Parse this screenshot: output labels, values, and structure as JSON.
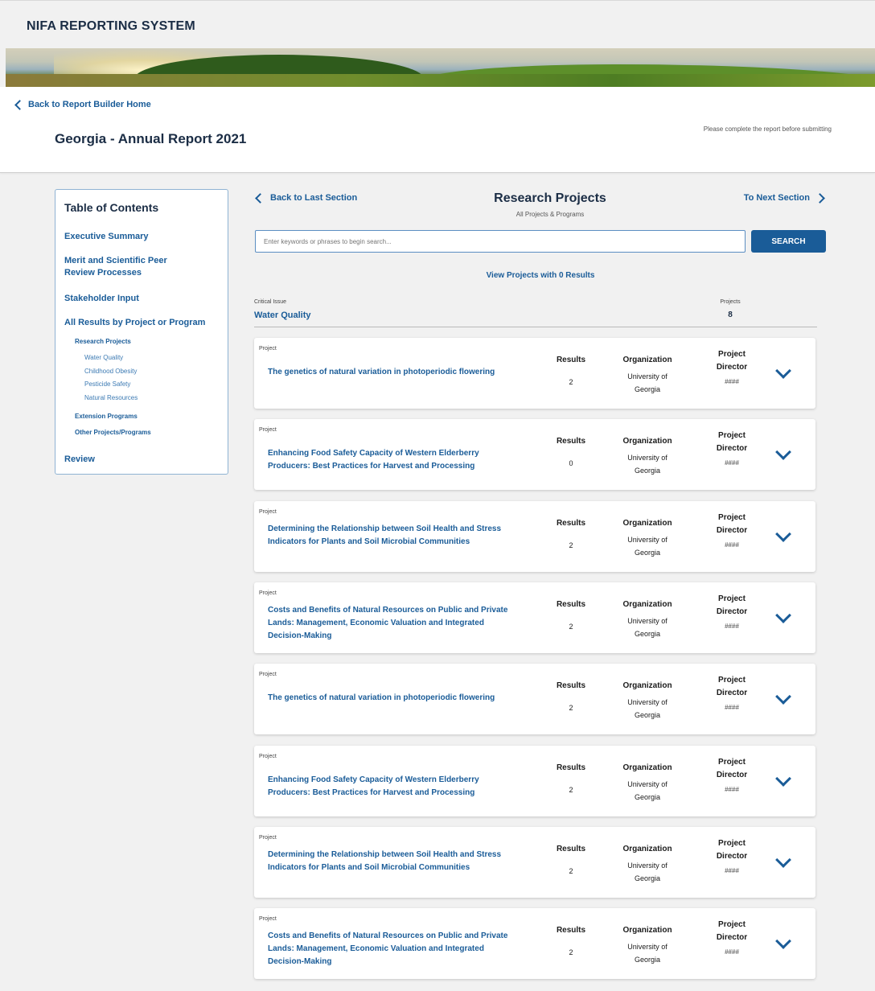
{
  "app": {
    "title": "NIFA REPORTING SYSTEM"
  },
  "header": {
    "back_link": "Back to Report Builder Home",
    "report_title": "Georgia - Annual Report 2021",
    "note": "Please complete the report before submitting"
  },
  "toc": {
    "title": "Table of Contents",
    "items": [
      {
        "label": "Executive Summary",
        "level": 1
      },
      {
        "label": "Merit and Scientific Peer Review Processes",
        "level": 1
      },
      {
        "label": "Stakeholder Input",
        "level": 1
      },
      {
        "label": "All Results by Project or Program",
        "level": 1
      },
      {
        "label": "Research Projects",
        "level": 2
      },
      {
        "label": "Water Quality",
        "level": 3
      },
      {
        "label": "Childhood Obesity",
        "level": 3
      },
      {
        "label": "Pesticide Safety",
        "level": 3
      },
      {
        "label": "Natural Resources",
        "level": 3
      },
      {
        "label": "Extension Programs",
        "level": 2
      },
      {
        "label": "Other Projects/Programs",
        "level": 2
      },
      {
        "label": "Review",
        "level": 1
      }
    ]
  },
  "section": {
    "back": "Back to Last Section",
    "next": "To Next Section",
    "title": "Research Projects",
    "subtitle": "All Projects & Programs"
  },
  "search": {
    "placeholder": "Enter keywords or phrases to begin search...",
    "button": "SEARCH"
  },
  "zero_results_link": "View Projects with 0 Results",
  "critical_issue": {
    "label": "Critical Issue",
    "value": "Water Quality",
    "projects_label": "Projects",
    "projects_count": "8"
  },
  "columns": {
    "kind": "Project",
    "results": "Results",
    "organization": "Organization",
    "director": "Project Director"
  },
  "projects": [
    {
      "title": "The genetics of natural variation in photoperiodic flowering",
      "results": "2",
      "organization": "University of Georgia",
      "director": "####"
    },
    {
      "title": "Enhancing Food Safety Capacity of Western Elderberry Producers: Best Practices for Harvest and Processing",
      "results": "0",
      "organization": "University of Georgia",
      "director": "####"
    },
    {
      "title": "Determining the Relationship between Soil Health and Stress Indicators for Plants and Soil Microbial Communities",
      "results": "2",
      "organization": "University of Georgia",
      "director": "####"
    },
    {
      "title": "Costs and Benefits of Natural Resources on Public and Private Lands: Management, Economic Valuation and Integrated Decision-Making",
      "results": "2",
      "organization": "University of Georgia",
      "director": "####"
    },
    {
      "title": "The genetics of natural variation in photoperiodic flowering",
      "results": "2",
      "organization": "University of Georgia",
      "director": "####"
    },
    {
      "title": "Enhancing Food Safety Capacity of Western Elderberry Producers: Best Practices for Harvest and Processing",
      "results": "2",
      "organization": "University of Georgia",
      "director": "####"
    },
    {
      "title": "Determining the Relationship between Soil Health and Stress Indicators for Plants and Soil Microbial Communities",
      "results": "2",
      "organization": "University of Georgia",
      "director": "####"
    },
    {
      "title": "Costs and Benefits of Natural Resources on Public and Private Lands: Management, Economic Valuation and Integrated Decision-Making",
      "results": "2",
      "organization": "University of Georgia",
      "director": "####"
    }
  ],
  "colors": {
    "accent": "#1a5c98",
    "heading": "#1b2d45",
    "background": "#f1f1f1"
  }
}
